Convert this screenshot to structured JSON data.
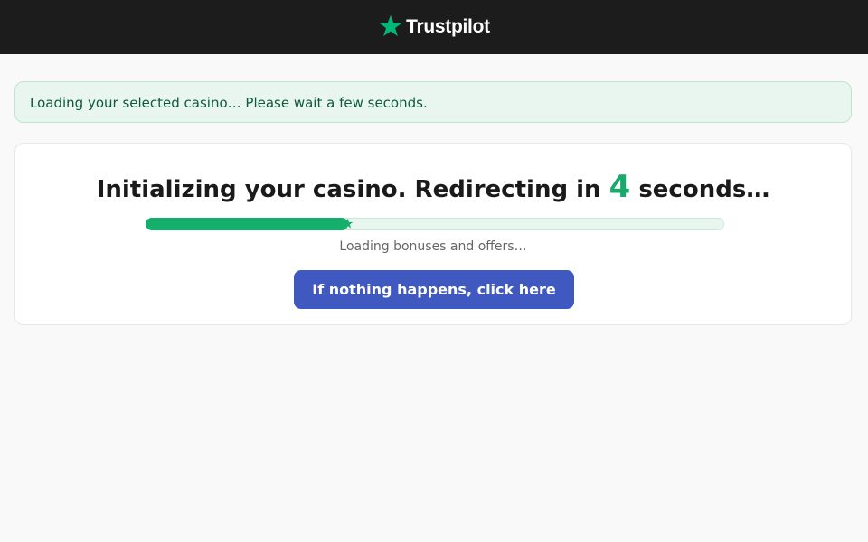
{
  "header": {
    "brand": "Trustpilot",
    "logo_icon": "star-icon",
    "background_color": "#1c1c1c",
    "star_color": "#00b67a"
  },
  "notice": {
    "text": "Loading your selected casino… Please wait a few seconds."
  },
  "card": {
    "heading_before": "Initializing your casino. Redirecting in ",
    "countdown": "4",
    "heading_after": " seconds…",
    "progress_fraction": 0.35,
    "status_text": "Loading bonuses and offers…",
    "button_label": "If nothing happens, click here"
  },
  "colors": {
    "accent_green": "#14b06b",
    "button_blue": "#3f59c1"
  }
}
